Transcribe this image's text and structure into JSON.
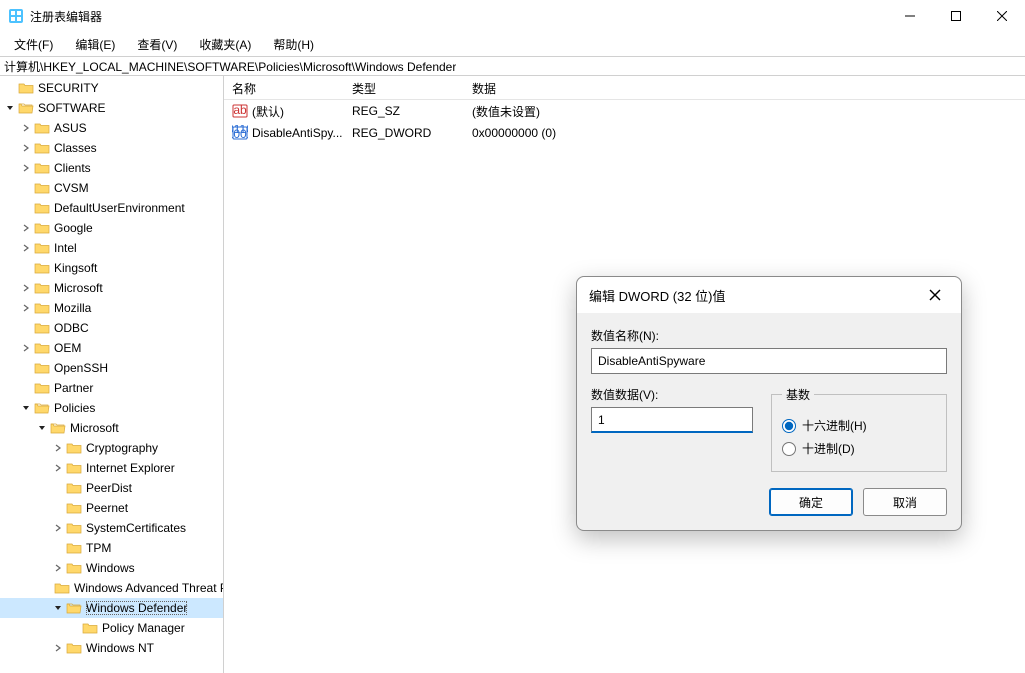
{
  "window": {
    "title": "注册表编辑器",
    "menus": {
      "file": "文件(F)",
      "edit": "编辑(E)",
      "view": "查看(V)",
      "favorites": "收藏夹(A)",
      "help": "帮助(H)"
    },
    "address": "计算机\\HKEY_LOCAL_MACHINE\\SOFTWARE\\Policies\\Microsoft\\Windows Defender"
  },
  "tree": {
    "items": [
      {
        "depth": 0,
        "expander": "none",
        "label": "SECURITY"
      },
      {
        "depth": 0,
        "expander": "open",
        "label": "SOFTWARE"
      },
      {
        "depth": 1,
        "expander": "closed",
        "label": "ASUS"
      },
      {
        "depth": 1,
        "expander": "closed",
        "label": "Classes"
      },
      {
        "depth": 1,
        "expander": "closed",
        "label": "Clients"
      },
      {
        "depth": 1,
        "expander": "none",
        "label": "CVSM"
      },
      {
        "depth": 1,
        "expander": "none",
        "label": "DefaultUserEnvironment"
      },
      {
        "depth": 1,
        "expander": "closed",
        "label": "Google"
      },
      {
        "depth": 1,
        "expander": "closed",
        "label": "Intel"
      },
      {
        "depth": 1,
        "expander": "none",
        "label": "Kingsoft"
      },
      {
        "depth": 1,
        "expander": "closed",
        "label": "Microsoft"
      },
      {
        "depth": 1,
        "expander": "closed",
        "label": "Mozilla"
      },
      {
        "depth": 1,
        "expander": "none",
        "label": "ODBC"
      },
      {
        "depth": 1,
        "expander": "closed",
        "label": "OEM"
      },
      {
        "depth": 1,
        "expander": "none",
        "label": "OpenSSH"
      },
      {
        "depth": 1,
        "expander": "none",
        "label": "Partner"
      },
      {
        "depth": 1,
        "expander": "open",
        "label": "Policies"
      },
      {
        "depth": 2,
        "expander": "open",
        "label": "Microsoft"
      },
      {
        "depth": 3,
        "expander": "closed",
        "label": "Cryptography"
      },
      {
        "depth": 3,
        "expander": "closed",
        "label": "Internet Explorer"
      },
      {
        "depth": 3,
        "expander": "none",
        "label": "PeerDist"
      },
      {
        "depth": 3,
        "expander": "none",
        "label": "Peernet"
      },
      {
        "depth": 3,
        "expander": "closed",
        "label": "SystemCertificates"
      },
      {
        "depth": 3,
        "expander": "none",
        "label": "TPM"
      },
      {
        "depth": 3,
        "expander": "closed",
        "label": "Windows"
      },
      {
        "depth": 3,
        "expander": "none",
        "label": "Windows Advanced Threat Protection"
      },
      {
        "depth": 3,
        "expander": "open",
        "label": "Windows Defender",
        "selected": true
      },
      {
        "depth": 4,
        "expander": "none",
        "label": "Policy Manager"
      },
      {
        "depth": 3,
        "expander": "closed",
        "label": "Windows NT"
      }
    ]
  },
  "list": {
    "headers": {
      "name": "名称",
      "type": "类型",
      "data": "数据"
    },
    "rows": [
      {
        "icon": "string",
        "name": "(默认)",
        "type": "REG_SZ",
        "data": "(数值未设置)"
      },
      {
        "icon": "binary",
        "name": "DisableAntiSpy...",
        "type": "REG_DWORD",
        "data": "0x00000000 (0)"
      }
    ]
  },
  "dialog": {
    "title": "编辑 DWORD (32 位)值",
    "name_label": "数值名称(N):",
    "name_value": "DisableAntiSpyware",
    "data_label": "数值数据(V):",
    "data_value": "1",
    "base_legend": "基数",
    "radio_hex": "十六进制(H)",
    "radio_dec": "十进制(D)",
    "ok": "确定",
    "cancel": "取消"
  }
}
